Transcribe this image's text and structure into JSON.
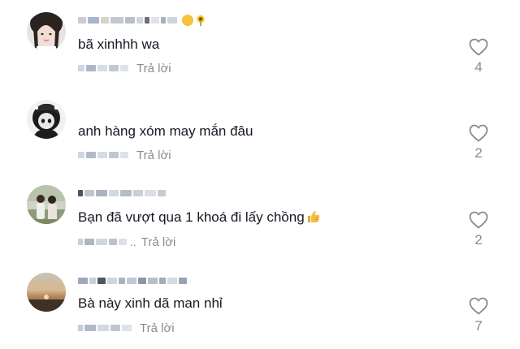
{
  "comments": [
    {
      "text": "bã xinhhh wa",
      "reply_label": "Trả lời",
      "likes": "4",
      "username_emojis": [
        "smiling-face-with-heart-eyes",
        "sunflower"
      ]
    },
    {
      "text": "anh hàng xóm may mắn đâu",
      "reply_label": "Trả lời",
      "likes": "2"
    },
    {
      "text": "Bạn đã vượt qua 1 khoá đi lấy chồng",
      "text_emoji": "thumbs-up",
      "reply_label": "Trả lời",
      "likes": "2"
    },
    {
      "text": "Bà này xinh dã man nhỉ",
      "reply_label": "Trả lời",
      "likes": "7"
    }
  ],
  "icons": {
    "like": "heart-outline-icon"
  },
  "colors": {
    "text": "#161823",
    "secondary": "#8a8b91",
    "background": "#ffffff"
  }
}
